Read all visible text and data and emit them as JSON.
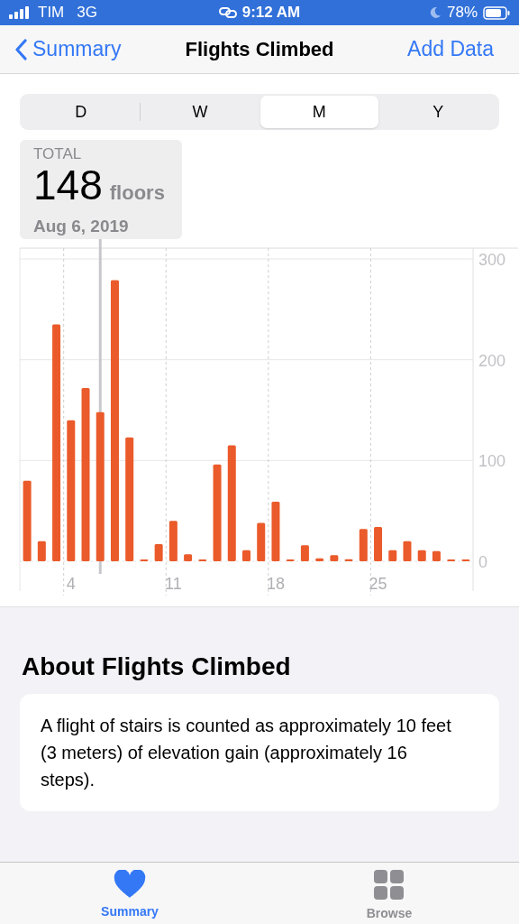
{
  "status_bar": {
    "carrier": "TIM",
    "network": "3G",
    "time": "9:12 AM",
    "battery": "78%"
  },
  "nav": {
    "back": "Summary",
    "title": "Flights Climbed",
    "action": "Add Data"
  },
  "segments": [
    {
      "label": "D",
      "selected": false
    },
    {
      "label": "W",
      "selected": false
    },
    {
      "label": "M",
      "selected": true
    },
    {
      "label": "Y",
      "selected": false
    }
  ],
  "callout": {
    "label": "TOTAL",
    "value": "148",
    "unit": "floors",
    "date": "Aug 6, 2019"
  },
  "chart_data": {
    "type": "bar",
    "x": [
      1,
      2,
      3,
      4,
      5,
      6,
      7,
      8,
      9,
      10,
      11,
      12,
      13,
      14,
      15,
      16,
      17,
      18,
      19,
      20,
      21,
      22,
      23,
      24,
      25,
      26,
      27,
      28,
      29,
      30,
      31
    ],
    "series": [
      {
        "color": "#eb5a2a",
        "values": [
          80,
          20,
          235,
          140,
          172,
          148,
          279,
          123,
          1,
          17,
          40,
          7,
          1,
          96,
          115,
          11,
          38,
          59,
          1,
          16,
          3,
          6,
          2,
          32,
          34,
          11,
          20,
          11,
          10,
          1,
          1
        ]
      }
    ],
    "xticks": [
      4,
      11,
      18,
      25
    ],
    "xlim": [
      0.5,
      31.5
    ],
    "yticks": [
      0,
      100,
      200,
      300
    ],
    "ylim": [
      0,
      300
    ],
    "grid": true,
    "ref_lines": [
      {
        "axis": "x",
        "value": 6
      }
    ]
  },
  "about": {
    "heading": "About Flights Climbed",
    "text": "A flight of stairs is counted as approximately 10 feet (3 meters) of elevation gain (approximately 16 steps)."
  },
  "tab_bar": [
    {
      "label": "Summary",
      "kind": "heart",
      "selected": true
    },
    {
      "label": "Browse",
      "kind": "grid",
      "selected": false
    }
  ]
}
